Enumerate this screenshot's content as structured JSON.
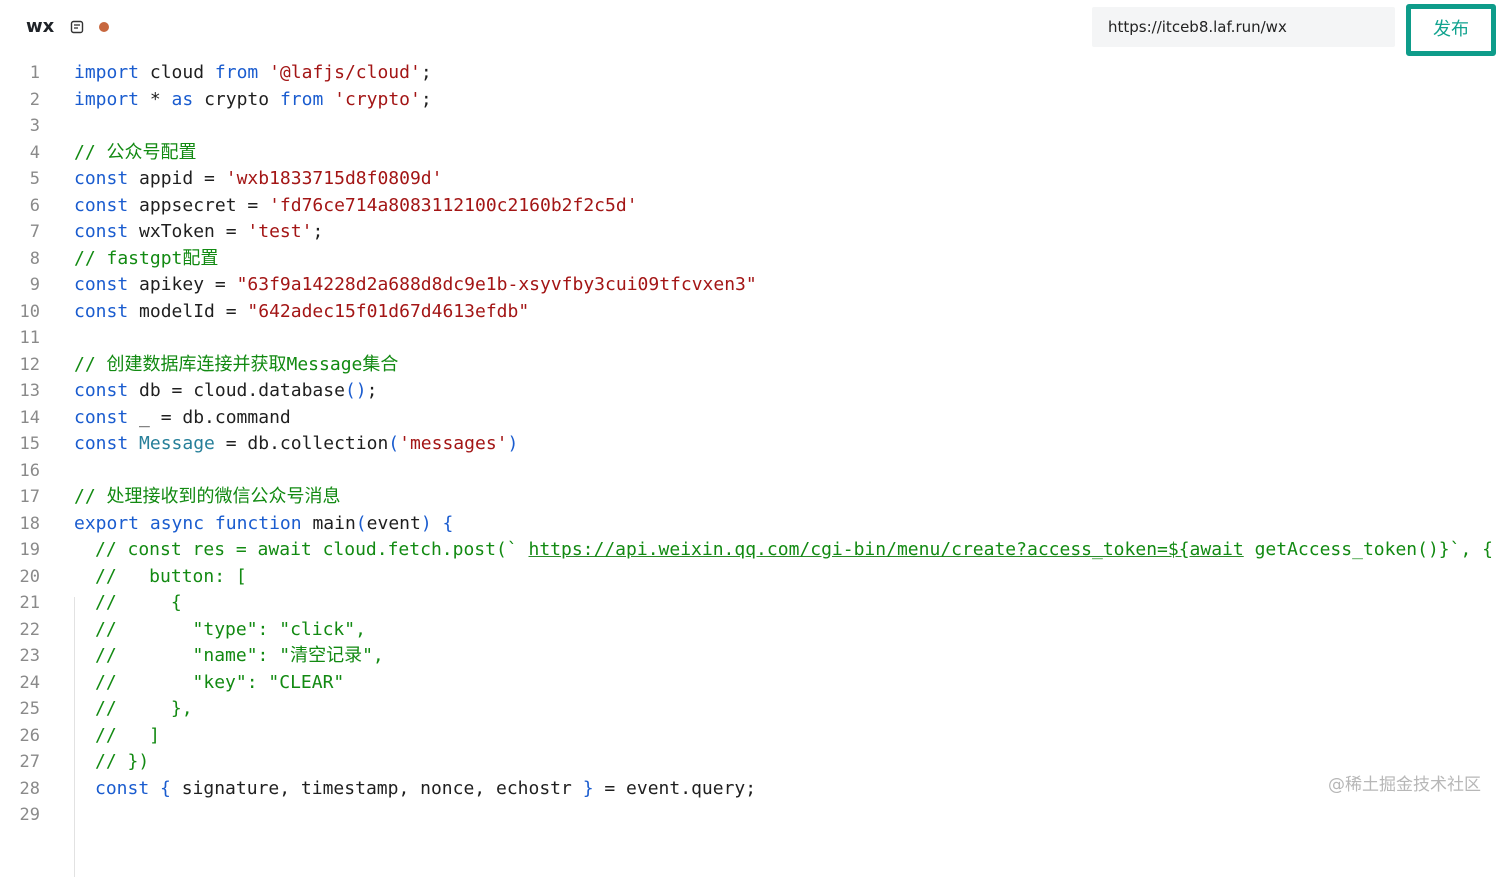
{
  "header": {
    "file_name": "wx",
    "url": "https://itceb8.laf.run/wx",
    "publish_label": "发布",
    "dirty_dot_color": "#c7673e",
    "accent_color": "#0e9c8a"
  },
  "editor": {
    "lines": [
      {
        "n": "1",
        "tokens": [
          {
            "t": "import",
            "c": "kw"
          },
          {
            "t": " cloud ",
            "c": ""
          },
          {
            "t": "from",
            "c": "kw"
          },
          {
            "t": " ",
            "c": ""
          },
          {
            "t": "'@lafjs/cloud'",
            "c": "str"
          },
          {
            "t": ";",
            "c": ""
          }
        ]
      },
      {
        "n": "2",
        "tokens": [
          {
            "t": "import",
            "c": "kw"
          },
          {
            "t": " * ",
            "c": ""
          },
          {
            "t": "as",
            "c": "kw"
          },
          {
            "t": " crypto ",
            "c": ""
          },
          {
            "t": "from",
            "c": "kw"
          },
          {
            "t": " ",
            "c": ""
          },
          {
            "t": "'crypto'",
            "c": "str"
          },
          {
            "t": ";",
            "c": ""
          }
        ]
      },
      {
        "n": "3",
        "tokens": []
      },
      {
        "n": "4",
        "tokens": [
          {
            "t": "// 公众号配置",
            "c": "com"
          }
        ]
      },
      {
        "n": "5",
        "tokens": [
          {
            "t": "const",
            "c": "kw"
          },
          {
            "t": " appid = ",
            "c": ""
          },
          {
            "t": "'wxb1833715d8f0809d'",
            "c": "str"
          }
        ]
      },
      {
        "n": "6",
        "tokens": [
          {
            "t": "const",
            "c": "kw"
          },
          {
            "t": " appsecret = ",
            "c": ""
          },
          {
            "t": "'fd76ce714a8083112100c2160b2f2c5d'",
            "c": "str"
          }
        ]
      },
      {
        "n": "7",
        "tokens": [
          {
            "t": "const",
            "c": "kw"
          },
          {
            "t": " wxToken = ",
            "c": ""
          },
          {
            "t": "'test'",
            "c": "str"
          },
          {
            "t": ";",
            "c": ""
          }
        ]
      },
      {
        "n": "8",
        "tokens": [
          {
            "t": "// fastgpt配置",
            "c": "com"
          }
        ]
      },
      {
        "n": "9",
        "tokens": [
          {
            "t": "const",
            "c": "kw"
          },
          {
            "t": " apikey = ",
            "c": ""
          },
          {
            "t": "\"63f9a14228d2a688d8dc9e1b-xsyvfby3cui09tfcvxen3\"",
            "c": "str"
          }
        ]
      },
      {
        "n": "10",
        "tokens": [
          {
            "t": "const",
            "c": "kw"
          },
          {
            "t": " modelId = ",
            "c": ""
          },
          {
            "t": "\"642adec15f01d67d4613efdb\"",
            "c": "str"
          }
        ]
      },
      {
        "n": "11",
        "tokens": []
      },
      {
        "n": "12",
        "tokens": [
          {
            "t": "// 创建数据库连接并获取Message集合",
            "c": "com"
          }
        ]
      },
      {
        "n": "13",
        "tokens": [
          {
            "t": "const",
            "c": "kw"
          },
          {
            "t": " db = cloud.database",
            "c": ""
          },
          {
            "t": "()",
            "c": "kw"
          },
          {
            "t": ";",
            "c": ""
          }
        ]
      },
      {
        "n": "14",
        "tokens": [
          {
            "t": "const",
            "c": "kw"
          },
          {
            "t": " _ = db.command",
            "c": ""
          }
        ]
      },
      {
        "n": "15",
        "tokens": [
          {
            "t": "const",
            "c": "kw"
          },
          {
            "t": " ",
            "c": ""
          },
          {
            "t": "Message",
            "c": "ty"
          },
          {
            "t": " = db.collection",
            "c": ""
          },
          {
            "t": "(",
            "c": "kw"
          },
          {
            "t": "'messages'",
            "c": "str"
          },
          {
            "t": ")",
            "c": "kw"
          }
        ]
      },
      {
        "n": "16",
        "tokens": []
      },
      {
        "n": "17",
        "tokens": [
          {
            "t": "// 处理接收到的微信公众号消息",
            "c": "com"
          }
        ]
      },
      {
        "n": "18",
        "tokens": [
          {
            "t": "export",
            "c": "kw"
          },
          {
            "t": " ",
            "c": ""
          },
          {
            "t": "async",
            "c": "kw"
          },
          {
            "t": " ",
            "c": ""
          },
          {
            "t": "function",
            "c": "kw"
          },
          {
            "t": " main",
            "c": ""
          },
          {
            "t": "(",
            "c": "kw"
          },
          {
            "t": "event",
            "c": ""
          },
          {
            "t": ")",
            "c": "kw"
          },
          {
            "t": " ",
            "c": ""
          },
          {
            "t": "{",
            "c": "kw"
          }
        ]
      },
      {
        "n": "19",
        "indent": true,
        "tokens": [
          {
            "t": "// const res = await cloud.fetch.post(` ",
            "c": "com"
          },
          {
            "t": "https://api.weixin.qq.com/cgi-bin/menu/create?access_token=${await",
            "c": "com link"
          },
          {
            "t": " getAccess_token()}`, {",
            "c": "com"
          }
        ]
      },
      {
        "n": "20",
        "indent": true,
        "tokens": [
          {
            "t": "//   button: [",
            "c": "com"
          }
        ]
      },
      {
        "n": "21",
        "indent": true,
        "tokens": [
          {
            "t": "//     {",
            "c": "com"
          }
        ]
      },
      {
        "n": "22",
        "indent": true,
        "tokens": [
          {
            "t": "//       \"type\": \"click\",",
            "c": "com"
          }
        ]
      },
      {
        "n": "23",
        "indent": true,
        "tokens": [
          {
            "t": "//       \"name\": \"清空记录\",",
            "c": "com"
          }
        ]
      },
      {
        "n": "24",
        "indent": true,
        "tokens": [
          {
            "t": "//       \"key\": \"CLEAR\"",
            "c": "com"
          }
        ]
      },
      {
        "n": "25",
        "indent": true,
        "tokens": [
          {
            "t": "//     },",
            "c": "com"
          }
        ]
      },
      {
        "n": "26",
        "indent": true,
        "tokens": [
          {
            "t": "//   ]",
            "c": "com"
          }
        ]
      },
      {
        "n": "27",
        "indent": true,
        "tokens": [
          {
            "t": "// })",
            "c": "com"
          }
        ]
      },
      {
        "n": "28",
        "indent": true,
        "tokens": [
          {
            "t": "const",
            "c": "kw"
          },
          {
            "t": " ",
            "c": ""
          },
          {
            "t": "{",
            "c": "kw"
          },
          {
            "t": " signature, timestamp, nonce, echostr ",
            "c": ""
          },
          {
            "t": "}",
            "c": "kw"
          },
          {
            "t": " = event.query;",
            "c": ""
          }
        ]
      },
      {
        "n": "29",
        "tokens": []
      }
    ]
  },
  "watermark": "@稀土掘金技术社区"
}
